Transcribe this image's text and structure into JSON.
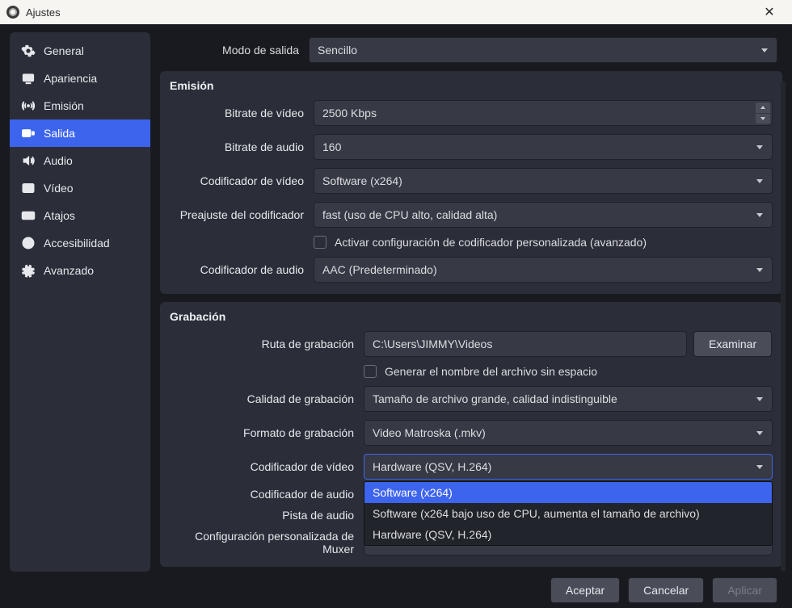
{
  "window": {
    "title": "Ajustes"
  },
  "sidebar": {
    "items": [
      {
        "id": "general",
        "label": "General"
      },
      {
        "id": "apariencia",
        "label": "Apariencia"
      },
      {
        "id": "emision",
        "label": "Emisión"
      },
      {
        "id": "salida",
        "label": "Salida"
      },
      {
        "id": "audio",
        "label": "Audio"
      },
      {
        "id": "video",
        "label": "Vídeo"
      },
      {
        "id": "atajos",
        "label": "Atajos"
      },
      {
        "id": "accesibilidad",
        "label": "Accesibilidad"
      },
      {
        "id": "avanzado",
        "label": "Avanzado"
      }
    ],
    "active_index": 3
  },
  "output_mode": {
    "label": "Modo de salida",
    "value": "Sencillo"
  },
  "streaming": {
    "title": "Emisión",
    "video_bitrate": {
      "label": "Bitrate de vídeo",
      "value": "2500 Kbps"
    },
    "audio_bitrate": {
      "label": "Bitrate de audio",
      "value": "160"
    },
    "video_encoder": {
      "label": "Codificador de vídeo",
      "value": "Software (x264)"
    },
    "encoder_preset": {
      "label": "Preajuste del codificador",
      "value": "fast (uso de CPU alto, calidad alta)"
    },
    "custom_conf": {
      "label": "Activar configuración de codificador personalizada (avanzado)"
    },
    "audio_encoder": {
      "label": "Codificador de audio",
      "value": "AAC (Predeterminado)"
    }
  },
  "recording": {
    "title": "Grabación",
    "path": {
      "label": "Ruta de grabación",
      "value": "C:\\Users\\JIMMY\\Videos",
      "browse": "Examinar"
    },
    "no_space": {
      "label": "Generar el nombre del archivo sin espacio"
    },
    "quality": {
      "label": "Calidad de grabación",
      "value": "Tamaño de archivo grande, calidad indistinguible"
    },
    "format": {
      "label": "Formato de grabación",
      "value": "Video Matroska (.mkv)"
    },
    "video_encoder": {
      "label": "Codificador de vídeo",
      "value": "Hardware (QSV, H.264)",
      "options": [
        "Software (x264)",
        "Software (x264 bajo uso de CPU, aumenta el tamaño de archivo)",
        "Hardware (QSV, H.264)"
      ],
      "highlighted_index": 0
    },
    "audio_encoder": {
      "label": "Codificador de audio"
    },
    "audio_track": {
      "label": "Pista de audio"
    },
    "muxer": {
      "label": "Configuración personalizada de Muxer"
    }
  },
  "footer": {
    "accept": "Aceptar",
    "cancel": "Cancelar",
    "apply": "Aplicar"
  }
}
